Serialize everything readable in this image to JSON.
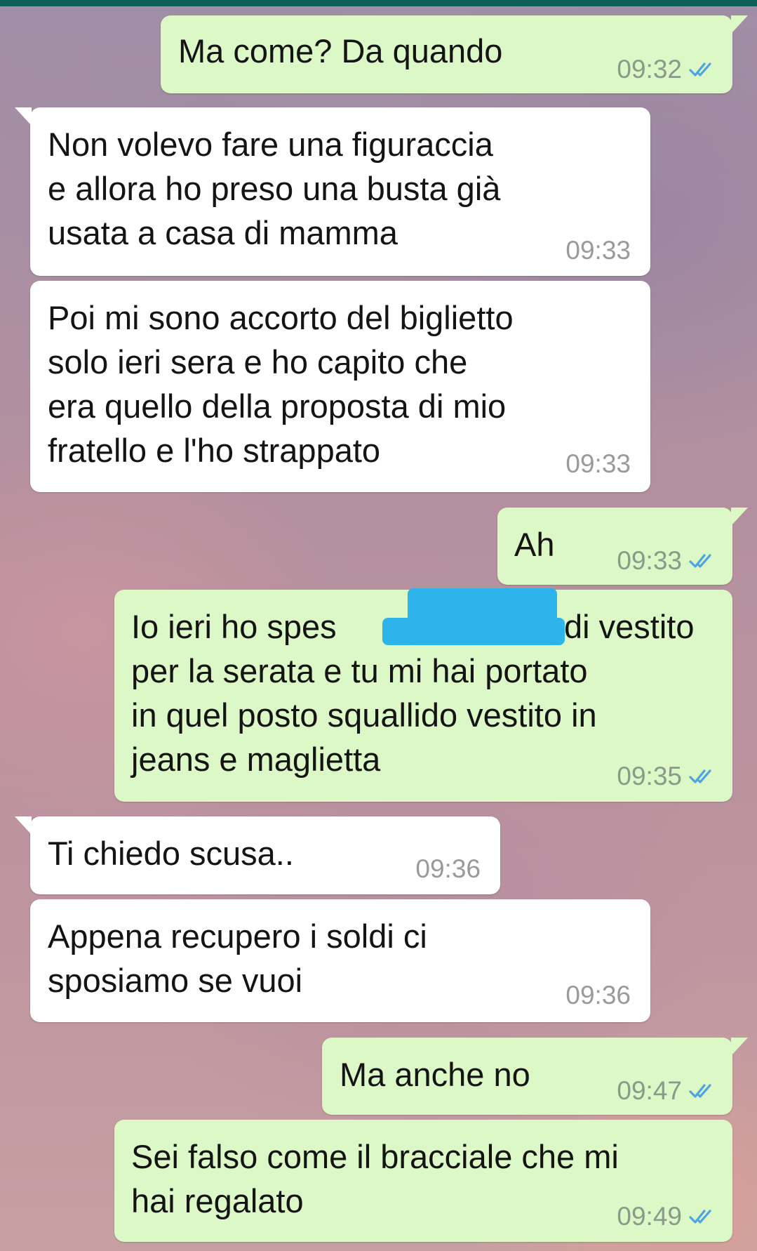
{
  "colors": {
    "top_bar": "#0d5f56",
    "outgoing_bubble": "#dcf8c6",
    "incoming_bubble": "#ffffff",
    "read_ticks": "#4fa3e0",
    "redaction": "#2db4ea"
  },
  "icons": {
    "read_receipt": "double-check-icon"
  },
  "messages": [
    {
      "direction": "out",
      "text": "Ma come? Da quando",
      "time": "09:32",
      "status": "read"
    },
    {
      "direction": "in",
      "text": "Non volevo fare una figuraccia\ne allora ho preso una busta già\nusata a casa di mamma",
      "time": "09:33"
    },
    {
      "direction": "in",
      "text": "Poi mi sono accorto del biglietto\nsolo ieri sera e ho capito che\nera quello della proposta di mio\nfratello e l'ho strappato",
      "time": "09:33"
    },
    {
      "direction": "out",
      "text": "Ah",
      "time": "09:33",
      "status": "read"
    },
    {
      "direction": "out",
      "text_line1_start": "Io ieri ho spes",
      "text_line1_end": "di vestito",
      "text_rest": "per la serata e tu mi hai portato\nin quel posto squallido vestito in\njeans e maglietta",
      "time": "09:35",
      "status": "read",
      "redacted": true
    },
    {
      "direction": "in",
      "text": "Ti chiedo scusa..",
      "time": "09:36"
    },
    {
      "direction": "in",
      "text": "Appena recupero i soldi ci\nsposiamo se vuoi",
      "time": "09:36"
    },
    {
      "direction": "out",
      "text": "Ma anche no",
      "time": "09:47",
      "status": "read"
    },
    {
      "direction": "out",
      "text": "Sei falso come il bracciale che mi\nhai regalato",
      "time": "09:49",
      "status": "read"
    }
  ]
}
